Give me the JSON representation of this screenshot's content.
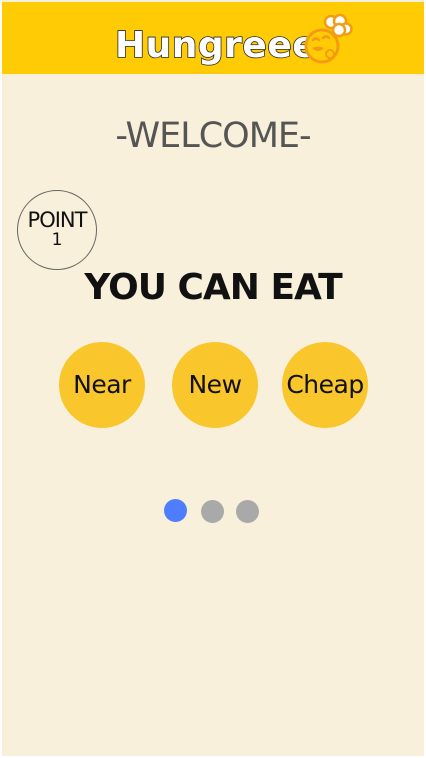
{
  "header": {
    "brand": "Hungreee",
    "logo_icon": "chef-chick-icon",
    "colors": {
      "background": "#ffcb05",
      "accent": "#f39c12"
    }
  },
  "welcome": {
    "title": "-WELCOME-"
  },
  "point": {
    "label": "POINT",
    "value": "1"
  },
  "headline": "YOU CAN EAT",
  "filters": [
    {
      "label": "Near"
    },
    {
      "label": "New"
    },
    {
      "label": "Cheap"
    }
  ],
  "pager": {
    "active_page": 1,
    "total_pages": 3,
    "active_color": "#4f7dff",
    "inactive_color": "#a9a9a9"
  },
  "colors": {
    "page_background": "#f8f0da",
    "pill": "#f9c62b"
  }
}
